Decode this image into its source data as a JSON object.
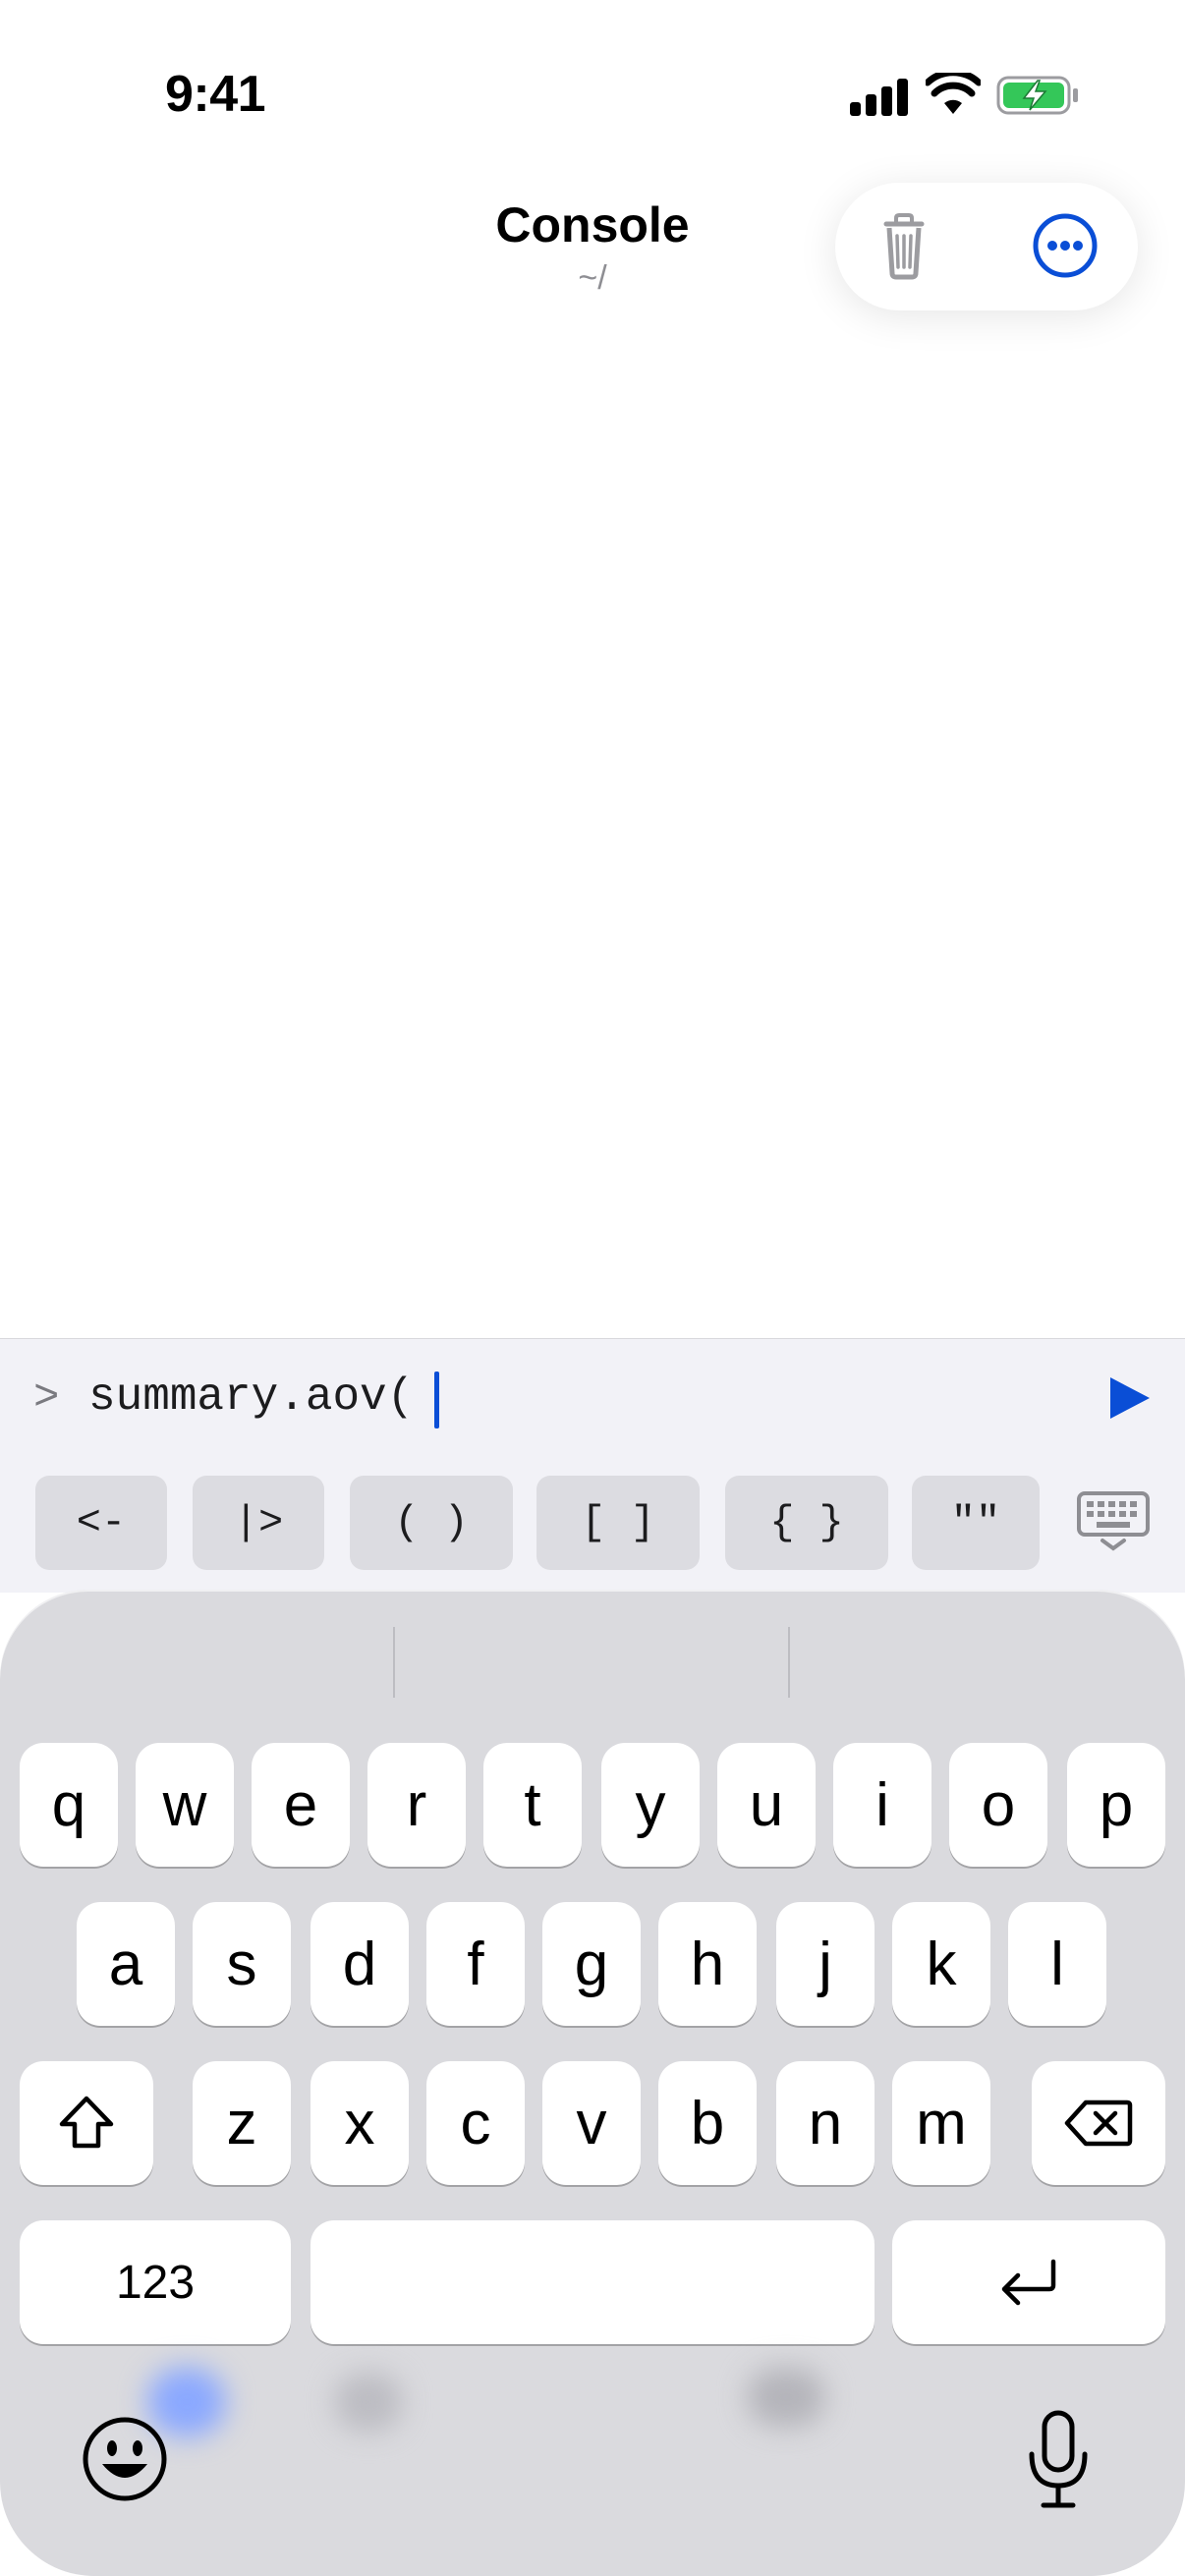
{
  "status_bar": {
    "time": "9:41"
  },
  "header": {
    "title": "Console",
    "subtitle": "~/"
  },
  "icons": {
    "trash": "trash-icon",
    "more": "ellipsis-circle-icon",
    "run": "play-icon",
    "keyboard_dismiss": "keyboard-dismiss-icon",
    "shift": "shift-icon",
    "backspace": "backspace-icon",
    "return": "return-icon",
    "emoji": "emoji-icon",
    "mic": "microphone-icon"
  },
  "colors": {
    "accent": "#0a4ed6",
    "battery_fill": "#34c759"
  },
  "console": {
    "prompt": ">",
    "command": "summary.aov("
  },
  "symbol_bar": [
    "<-",
    "|>",
    "( )",
    "[ ]",
    "{ }",
    "\"\""
  ],
  "keyboard": {
    "row1": [
      "q",
      "w",
      "e",
      "r",
      "t",
      "y",
      "u",
      "i",
      "o",
      "p"
    ],
    "row2": [
      "a",
      "s",
      "d",
      "f",
      "g",
      "h",
      "j",
      "k",
      "l"
    ],
    "row3": [
      "z",
      "x",
      "c",
      "v",
      "b",
      "n",
      "m"
    ],
    "numbers_label": "123"
  }
}
